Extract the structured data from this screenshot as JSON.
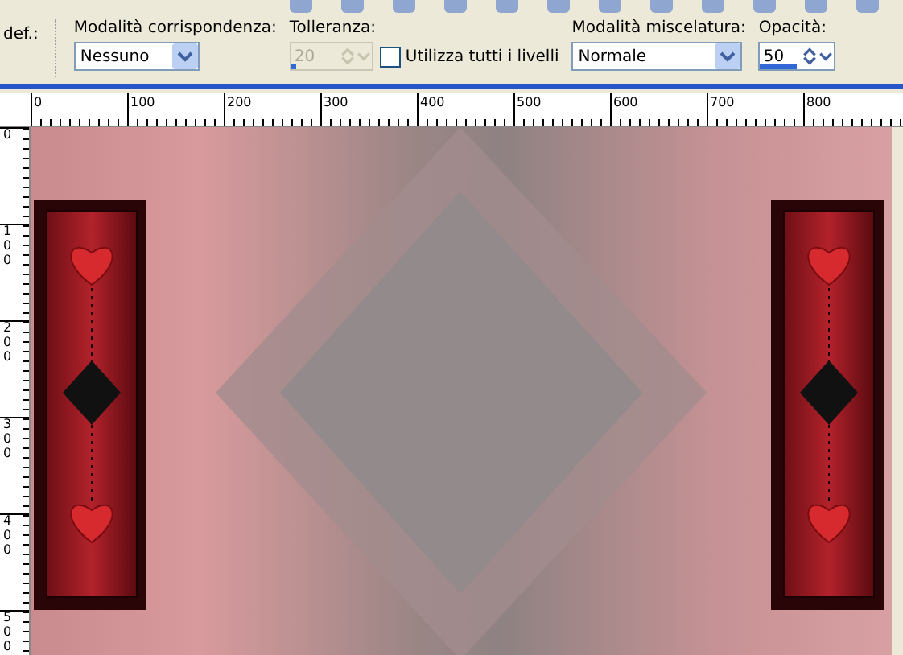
{
  "toolbar": {
    "preset_label": "def.:",
    "match_mode": {
      "label": "Modalità corrispondenza:",
      "value": "Nessuno"
    },
    "tolerance": {
      "label": "Tolleranza:",
      "value": "20",
      "disabled": true,
      "level": 0.06
    },
    "all_layers": {
      "label": "Utilizza tutti i livelli",
      "checked": false
    },
    "blend_mode": {
      "label": "Modalità miscelatura:",
      "value": "Normale"
    },
    "opacity": {
      "label": "Opacità:",
      "value": "50",
      "disabled": false,
      "level": 0.5
    }
  },
  "ruler_horizontal": [
    "0",
    "100",
    "200",
    "300",
    "400",
    "500",
    "600",
    "700",
    "800"
  ],
  "ruler_vertical": [
    "0",
    "100",
    "200",
    "300",
    "400",
    "500"
  ]
}
